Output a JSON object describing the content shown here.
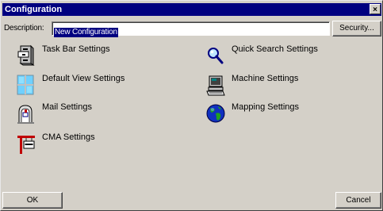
{
  "window": {
    "title": "Configuration",
    "close_glyph": "×"
  },
  "description": {
    "label": "Description:",
    "value": "New Configuration"
  },
  "buttons": {
    "security": "Security...",
    "ok": "OK",
    "cancel": "Cancel"
  },
  "settings": [
    {
      "label": "Task Bar Settings",
      "icon": "filing-cabinet-icon"
    },
    {
      "label": "Quick Search Settings",
      "icon": "magnifier-icon"
    },
    {
      "label": "Default View Settings",
      "icon": "window-panes-icon"
    },
    {
      "label": "Machine Settings",
      "icon": "computer-icon"
    },
    {
      "label": "Mail Settings",
      "icon": "mailbox-icon"
    },
    {
      "label": "Mapping Settings",
      "icon": "globe-icon"
    },
    {
      "label": "CMA Settings",
      "icon": "cma-sign-icon"
    }
  ],
  "colors": {
    "titlebar": "#000080",
    "dialog_face": "#d4d0c8",
    "selection": "#000080"
  }
}
